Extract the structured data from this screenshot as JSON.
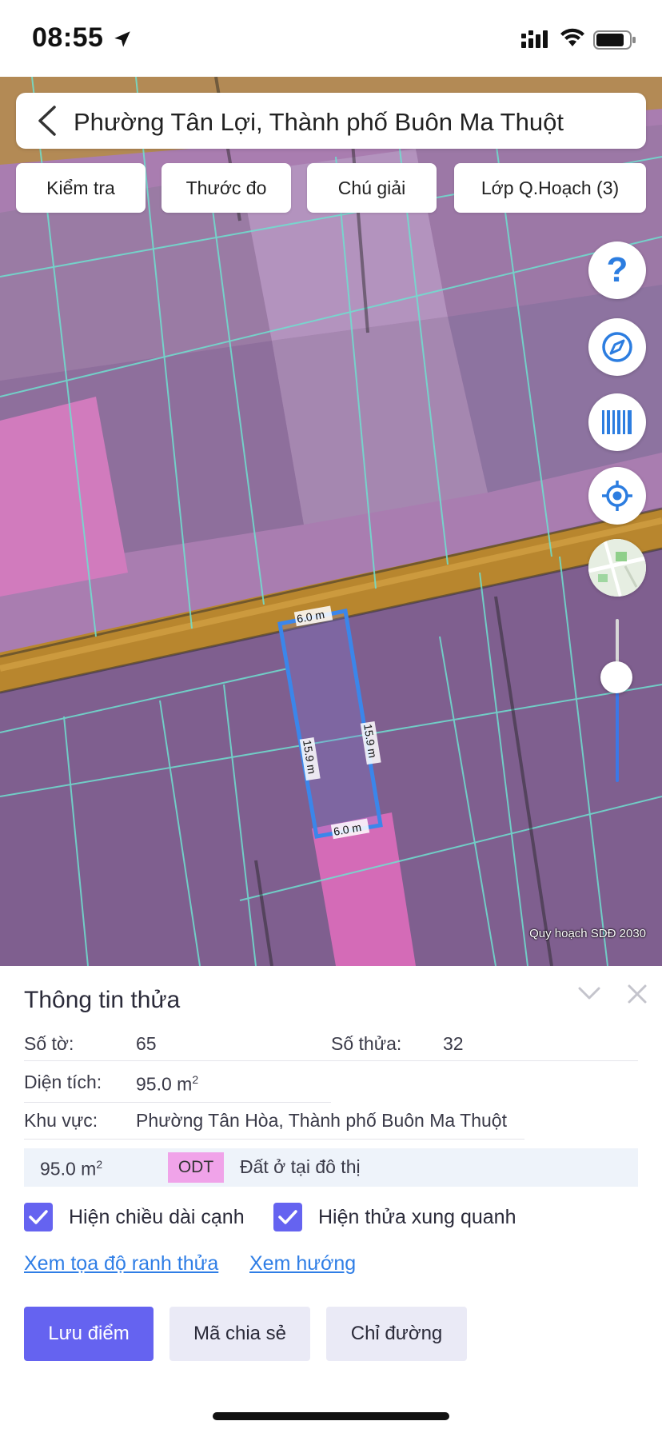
{
  "status_bar": {
    "time": "08:55"
  },
  "search": {
    "title": "Phường Tân Lợi, Thành phố Buôn Ma Thuột"
  },
  "map_tabs": [
    {
      "label": "Kiểm tra"
    },
    {
      "label": "Thước đo"
    },
    {
      "label": "Chú giải"
    },
    {
      "label": "Lớp Q.Hoạch (3)"
    }
  ],
  "map": {
    "fab_help_label": "?",
    "parcel_edges": {
      "top": "6.0 m",
      "bottom": "6.0 m",
      "left": "15.9 m",
      "right": "15.9 m"
    },
    "attribution": "Quy hoạch SDĐ 2030",
    "colors": {
      "parcel_outline": "#3b86ea",
      "planning_overlay": "#c46fd0",
      "road": "#b8862e",
      "parcel_lines": "#6fe0d0"
    }
  },
  "panel": {
    "title": "Thông tin thửa",
    "so_to_label": "Số tờ:",
    "so_to_value": "65",
    "so_thua_label": "Số thửa:",
    "so_thua_value": "32",
    "dien_tich_label": "Diện tích:",
    "dien_tich_value": "95.0 m",
    "dien_tich_unit_sup": "2",
    "khu_vuc_label": "Khu vực:",
    "khu_vuc_value": "Phường Tân Hòa, Thành phố Buôn Ma Thuột",
    "landuse": {
      "area": "95.0 m",
      "area_sup": "2",
      "code": "ODT",
      "name": "Đất ở tại đô thị",
      "code_color": "#f0a3e9"
    },
    "checkbox_edge_length": {
      "label": "Hiện chiều dài cạnh",
      "checked": true
    },
    "checkbox_neighbors": {
      "label": "Hiện thửa xung quanh",
      "checked": true
    },
    "link_coords": "Xem tọa độ ranh thửa",
    "link_direction": "Xem hướng",
    "buttons": {
      "save": "Lưu điểm",
      "share": "Mã chia sẻ",
      "directions": "Chỉ đường"
    },
    "accent": "#6563f0"
  }
}
